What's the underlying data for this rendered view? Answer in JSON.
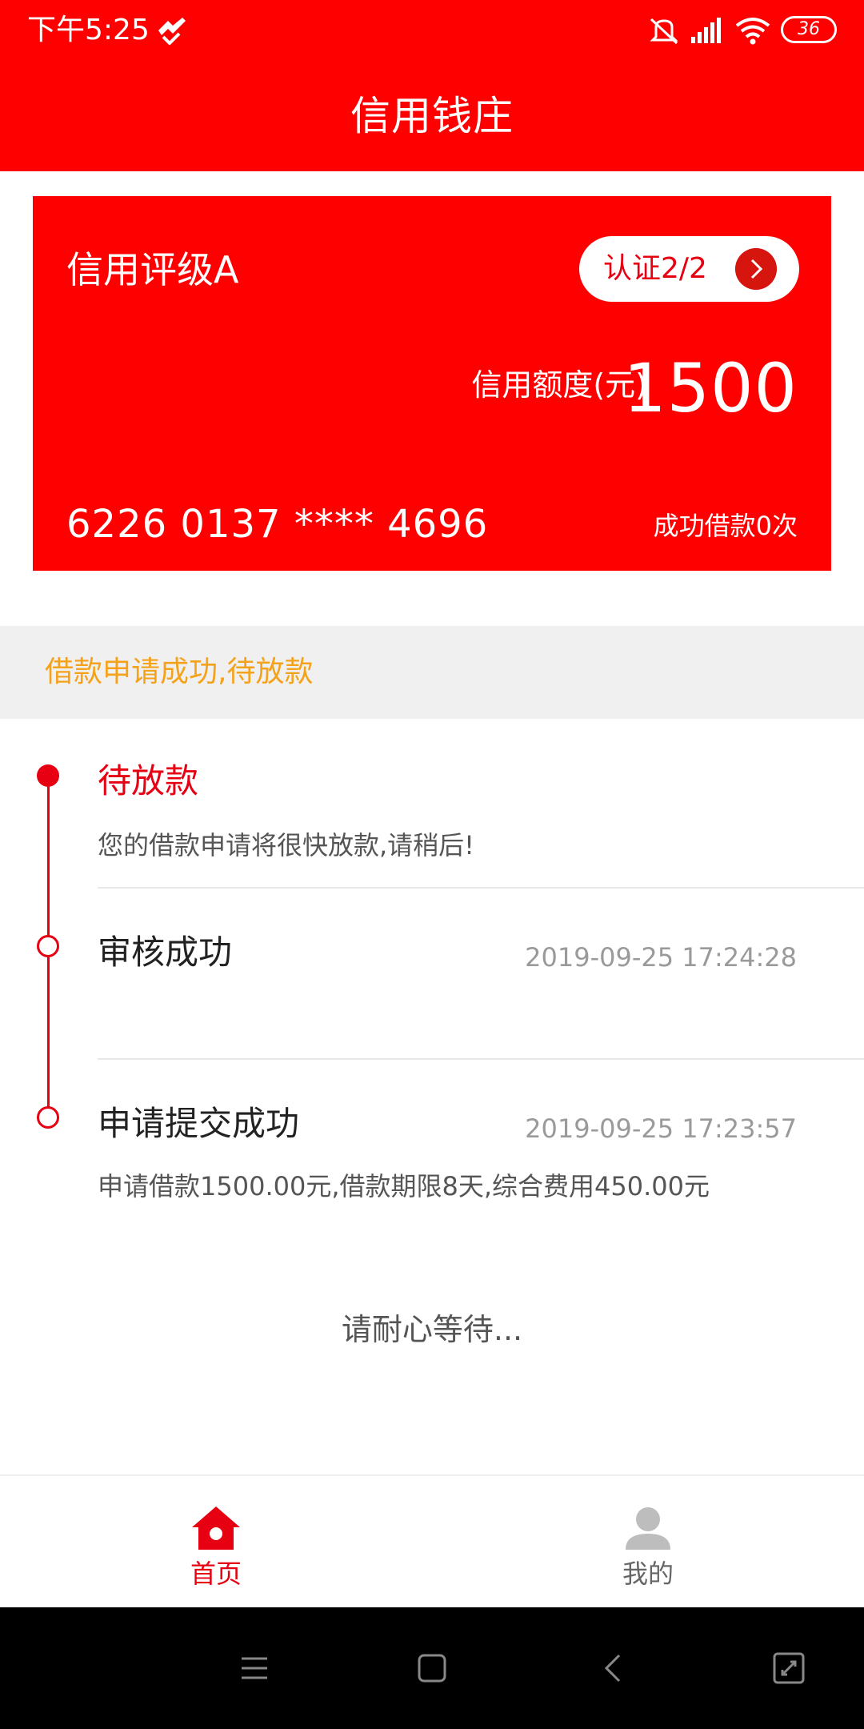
{
  "status_bar": {
    "time": "下午5:25",
    "battery": "36"
  },
  "header": {
    "title": "信用钱庄"
  },
  "card": {
    "rating": "信用评级A",
    "verify_label": "认证2/2",
    "limit_label": "信用额度(元)",
    "limit_value": "1500",
    "card_number": "6226 0137 **** 4696",
    "success_count": "成功借款0次"
  },
  "status_banner": {
    "text": "借款申请成功,待放款"
  },
  "timeline": [
    {
      "title": "待放款",
      "desc": "您的借款申请将很快放款,请稍后!",
      "time": ""
    },
    {
      "title": "审核成功",
      "desc": "",
      "time": "2019-09-25 17:24:28"
    },
    {
      "title": "申请提交成功",
      "desc": "申请借款1500.00元,借款期限8天,综合费用450.00元",
      "time": "2019-09-25 17:23:57"
    }
  ],
  "wait_text": "请耐心等待...",
  "bottom_nav": [
    {
      "label": "首页",
      "icon": "home-icon",
      "active": true
    },
    {
      "label": "我的",
      "icon": "user-icon",
      "active": false
    }
  ],
  "colors": {
    "brand_red": "#FF0000",
    "accent_red": "#E60012",
    "banner_orange": "#F5A21B",
    "inactive_gray": "#9A9A9A"
  }
}
